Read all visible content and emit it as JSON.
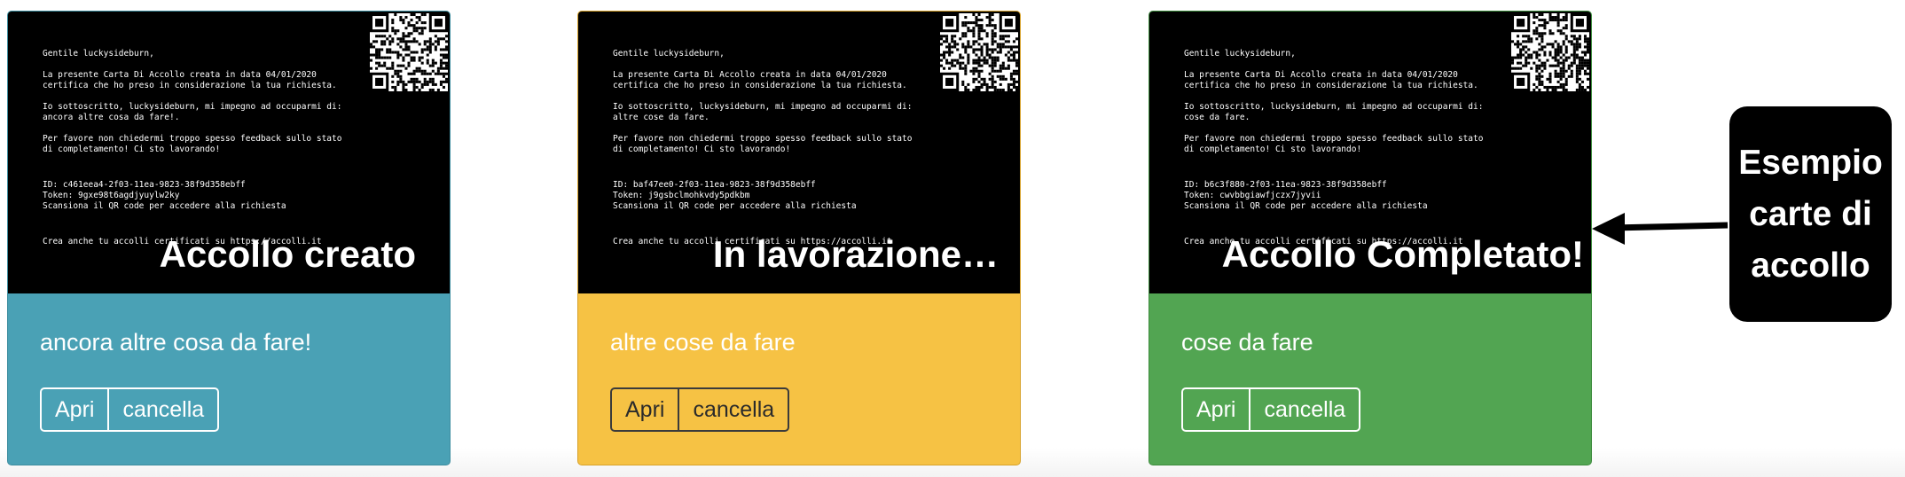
{
  "cards": [
    {
      "greeting": "Gentile luckysideburn,",
      "intro": "La presente Carta Di Accollo creata in data 04/01/2020\ncertifica che ho preso in considerazione la tua richiesta.",
      "commitment": "Io sottoscritto, luckysideburn, mi impegno ad occuparmi di:\nancora altre cosa da fare!.",
      "request": "Per favore non chiedermi troppo spesso feedback sullo stato\ndi completamento! Ci sto lavorando!",
      "id_line": "ID: c461eea4-2f03-11ea-9823-38f9d358ebff",
      "token_line": "Token: 9gxe98t6agdjyuylw2ky",
      "scan_line": "Scansiona il QR code per accedere alla richiesta",
      "footer": "Crea anche tu accolli certificati su https://accolli.it",
      "status": "Accollo creato",
      "title": "ancora altre cosa da fare!",
      "open_label": "Apri",
      "delete_label": "cancella",
      "color": "#4aa1b5"
    },
    {
      "greeting": "Gentile luckysideburn,",
      "intro": "La presente Carta Di Accollo creata in data 04/01/2020\ncertifica che ho preso in considerazione la tua richiesta.",
      "commitment": "Io sottoscritto, luckysideburn, mi impegno ad occuparmi di:\naltre cose da fare.",
      "request": "Per favore non chiedermi troppo spesso feedback sullo stato\ndi completamento! Ci sto lavorando!",
      "id_line": "ID: baf47ee0-2f03-11ea-9823-38f9d358ebff",
      "token_line": "Token: j9gsbclmohkvdy5pdkbm",
      "scan_line": "Scansiona il QR code per accedere alla richiesta",
      "footer": "Crea anche tu accolli certificati su https://accolli.it",
      "status": "In lavorazione…",
      "title": "altre cose da fare",
      "open_label": "Apri",
      "delete_label": "cancella",
      "color": "#f6c244"
    },
    {
      "greeting": "Gentile luckysideburn,",
      "intro": "La presente Carta Di Accollo creata in data 04/01/2020\ncertifica che ho preso in considerazione la tua richiesta.",
      "commitment": "Io sottoscritto, luckysideburn, mi impegno ad occuparmi di:\ncose da fare.",
      "request": "Per favore non chiedermi troppo spesso feedback sullo stato\ndi completamento! Ci sto lavorando!",
      "id_line": "ID: b6c3f880-2f03-11ea-9823-38f9d358ebff",
      "token_line": "Token: cwvbbgiawfjczx7jyvii",
      "scan_line": "Scansiona il QR code per accedere alla richiesta",
      "footer": "Crea anche tu accolli certificati su https://accolli.it",
      "status": "Accollo Completato!",
      "title": "cose da fare",
      "open_label": "Apri",
      "delete_label": "cancella",
      "color": "#52a552"
    }
  ],
  "callout": {
    "text": "Esempio\ncarte di\naccollo"
  }
}
